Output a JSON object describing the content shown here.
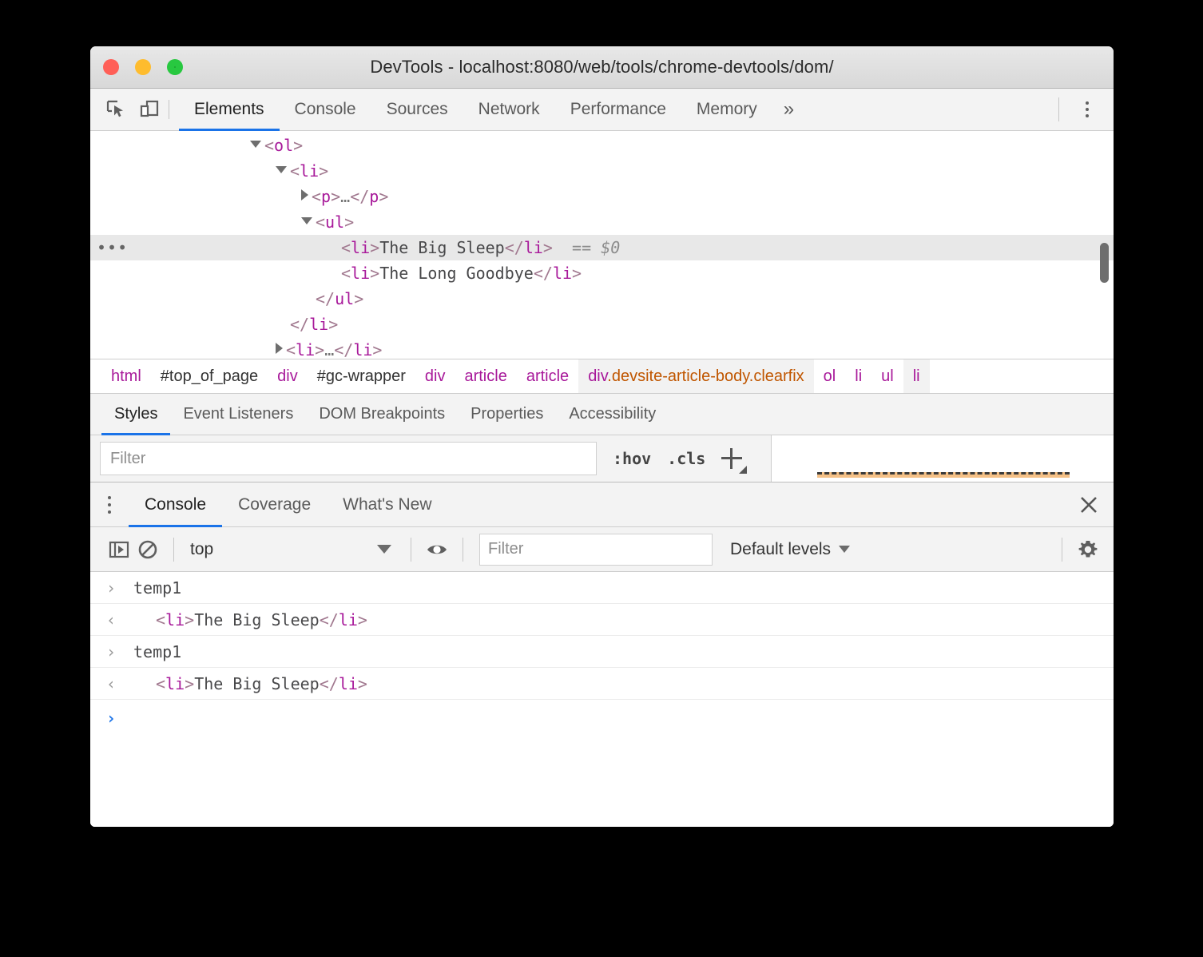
{
  "window": {
    "title": "DevTools - localhost:8080/web/tools/chrome-devtools/dom/",
    "lights": [
      "close",
      "minimize",
      "zoom"
    ]
  },
  "toolbar": {
    "icons": [
      {
        "name": "inspect-element-icon",
        "label": "inspect"
      },
      {
        "name": "device-toolbar-icon",
        "label": "device"
      }
    ],
    "tabs": [
      {
        "label": "Elements",
        "active": true
      },
      {
        "label": "Console",
        "active": false
      },
      {
        "label": "Sources",
        "active": false
      },
      {
        "label": "Network",
        "active": false
      },
      {
        "label": "Performance",
        "active": false
      },
      {
        "label": "Memory",
        "active": false
      }
    ],
    "overflow_label": "»",
    "menu_label": "more-options"
  },
  "dom_tree": {
    "rows": [
      {
        "indent": 0,
        "twisty": "down",
        "gutter": "",
        "segments": [
          {
            "t": "br",
            "v": "<"
          },
          {
            "t": "tag",
            "v": "ol"
          },
          {
            "t": "br",
            "v": ">"
          }
        ],
        "selected": false
      },
      {
        "indent": 1,
        "twisty": "down",
        "gutter": "",
        "segments": [
          {
            "t": "br",
            "v": "<"
          },
          {
            "t": "tag",
            "v": "li"
          },
          {
            "t": "br",
            "v": ">"
          }
        ],
        "selected": false
      },
      {
        "indent": 2,
        "twisty": "right",
        "gutter": "",
        "segments": [
          {
            "t": "br",
            "v": "<"
          },
          {
            "t": "tag",
            "v": "p"
          },
          {
            "t": "br",
            "v": ">"
          },
          {
            "t": "ell",
            "v": "…"
          },
          {
            "t": "br",
            "v": "</"
          },
          {
            "t": "tag",
            "v": "p"
          },
          {
            "t": "br",
            "v": ">"
          }
        ],
        "selected": false
      },
      {
        "indent": 2,
        "twisty": "down",
        "gutter": "",
        "segments": [
          {
            "t": "br",
            "v": "<"
          },
          {
            "t": "tag",
            "v": "ul"
          },
          {
            "t": "br",
            "v": ">"
          }
        ],
        "selected": false
      },
      {
        "indent": 3,
        "twisty": "blank",
        "gutter": "•••",
        "segments": [
          {
            "t": "br",
            "v": "<"
          },
          {
            "t": "tag",
            "v": "li"
          },
          {
            "t": "br",
            "v": ">"
          },
          {
            "t": "txt",
            "v": "The Big Sleep"
          },
          {
            "t": "br",
            "v": "</"
          },
          {
            "t": "tag",
            "v": "li"
          },
          {
            "t": "br",
            "v": ">"
          },
          {
            "t": "eq",
            "v": "  == "
          },
          {
            "t": "dollar",
            "v": "$0"
          }
        ],
        "selected": true
      },
      {
        "indent": 3,
        "twisty": "blank",
        "gutter": "",
        "segments": [
          {
            "t": "br",
            "v": "<"
          },
          {
            "t": "tag",
            "v": "li"
          },
          {
            "t": "br",
            "v": ">"
          },
          {
            "t": "txt",
            "v": "The Long Goodbye"
          },
          {
            "t": "br",
            "v": "</"
          },
          {
            "t": "tag",
            "v": "li"
          },
          {
            "t": "br",
            "v": ">"
          }
        ],
        "selected": false
      },
      {
        "indent": 2,
        "twisty": "blank",
        "gutter": "",
        "segments": [
          {
            "t": "br",
            "v": "</"
          },
          {
            "t": "tag",
            "v": "ul"
          },
          {
            "t": "br",
            "v": ">"
          }
        ],
        "selected": false
      },
      {
        "indent": 1,
        "twisty": "blank",
        "gutter": "",
        "segments": [
          {
            "t": "br",
            "v": "</"
          },
          {
            "t": "tag",
            "v": "li"
          },
          {
            "t": "br",
            "v": ">"
          }
        ],
        "selected": false
      },
      {
        "indent": 1,
        "twisty": "right",
        "gutter": "",
        "segments": [
          {
            "t": "br",
            "v": "<"
          },
          {
            "t": "tag",
            "v": "li"
          },
          {
            "t": "br",
            "v": ">"
          },
          {
            "t": "ell",
            "v": "…"
          },
          {
            "t": "br",
            "v": "</"
          },
          {
            "t": "tag",
            "v": "li"
          },
          {
            "t": "br",
            "v": ">"
          }
        ],
        "selected": false
      }
    ]
  },
  "breadcrumb": {
    "items": [
      {
        "name": "html",
        "kind": "tag",
        "selected": false
      },
      {
        "name": "#top_of_page",
        "kind": "id",
        "selected": false
      },
      {
        "name": "div",
        "kind": "tag",
        "selected": false
      },
      {
        "name": "#gc-wrapper",
        "kind": "id",
        "selected": false
      },
      {
        "name": "div",
        "kind": "tag",
        "selected": false
      },
      {
        "name": "article",
        "kind": "tag",
        "selected": false
      },
      {
        "name": "article",
        "kind": "tag",
        "selected": false
      },
      {
        "name": "div",
        "classes": ".devsite-article-body.clearfix",
        "kind": "tag",
        "selected": true
      },
      {
        "name": "ol",
        "kind": "tag",
        "selected": false
      },
      {
        "name": "li",
        "kind": "tag",
        "selected": false
      },
      {
        "name": "ul",
        "kind": "tag",
        "selected": false
      },
      {
        "name": "li",
        "kind": "tag",
        "selected": false,
        "highlight": true
      }
    ]
  },
  "styles_pane": {
    "tabs": [
      {
        "label": "Styles",
        "active": true
      },
      {
        "label": "Event Listeners",
        "active": false
      },
      {
        "label": "DOM Breakpoints",
        "active": false
      },
      {
        "label": "Properties",
        "active": false
      },
      {
        "label": "Accessibility",
        "active": false
      }
    ],
    "filter_placeholder": "Filter",
    "filter_value": "",
    "hov_label": ":hov",
    "cls_label": ".cls",
    "new_rule_label": "+"
  },
  "drawer": {
    "menu_label": "more-tools",
    "tabs": [
      {
        "label": "Console",
        "active": true
      },
      {
        "label": "Coverage",
        "active": false
      },
      {
        "label": "What's New",
        "active": false
      }
    ],
    "close_label": "✕",
    "toolbar": {
      "sidebar_toggle": "console-sidebar-icon",
      "clear_label": "clear-console-icon",
      "context_value": "top",
      "eye_label": "live-expression-icon",
      "filter_placeholder": "Filter",
      "filter_value": "",
      "levels_label": "Default levels",
      "settings_label": "settings-gear-icon"
    },
    "lines": [
      {
        "kind": "input",
        "arrow": "›",
        "segments": [
          {
            "t": "cmd",
            "v": "temp1"
          }
        ]
      },
      {
        "kind": "output",
        "arrow": "‹",
        "segments": [
          {
            "t": "br",
            "v": "<"
          },
          {
            "t": "tag",
            "v": "li"
          },
          {
            "t": "br",
            "v": ">"
          },
          {
            "t": "txt",
            "v": "The Big Sleep"
          },
          {
            "t": "br",
            "v": "</"
          },
          {
            "t": "tag",
            "v": "li"
          },
          {
            "t": "br",
            "v": ">"
          }
        ]
      },
      {
        "kind": "input",
        "arrow": "›",
        "segments": [
          {
            "t": "cmd",
            "v": "temp1"
          }
        ]
      },
      {
        "kind": "output",
        "arrow": "‹",
        "segments": [
          {
            "t": "br",
            "v": "<"
          },
          {
            "t": "tag",
            "v": "li"
          },
          {
            "t": "br",
            "v": ">"
          },
          {
            "t": "txt",
            "v": "The Big Sleep"
          },
          {
            "t": "br",
            "v": "</"
          },
          {
            "t": "tag",
            "v": "li"
          },
          {
            "t": "br",
            "v": ">"
          }
        ]
      },
      {
        "kind": "prompt",
        "arrow": "›",
        "segments": []
      }
    ]
  },
  "colors": {
    "accent": "#1a73e8",
    "tag": "#a8199a",
    "bracket": "#a1788f",
    "class": "#c05600",
    "text": "#48484a",
    "chrome_bg": "#f3f3f3"
  }
}
